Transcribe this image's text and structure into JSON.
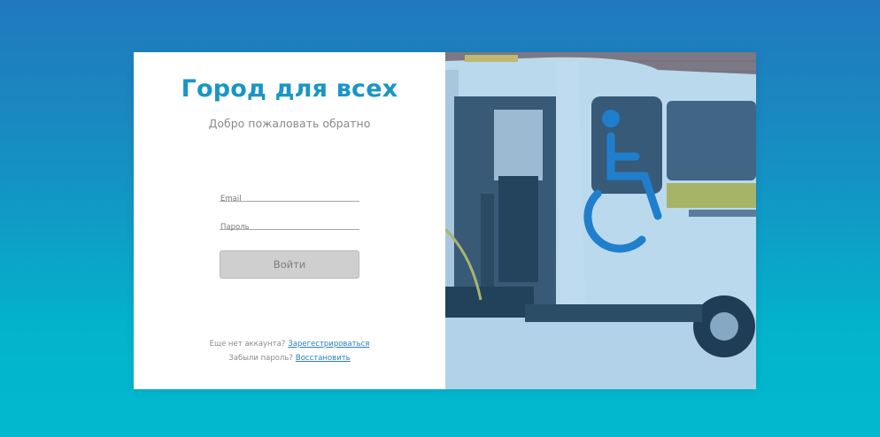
{
  "app": {
    "title": "Город для всех",
    "subtitle": "Добро пожаловать обратно"
  },
  "form": {
    "email_placeholder": "Email",
    "email_value": "",
    "password_placeholder": "Пароль",
    "password_value": "",
    "submit_label": "Войти"
  },
  "footer": {
    "register_prompt": "Еще нет аккаунта?",
    "register_link": "Зарегестрироваться",
    "recover_prompt": "Забыли пароль?",
    "recover_link": "Восстановить"
  },
  "colors": {
    "brand": "#1a96c4",
    "link": "#2a7fc0",
    "button_bg": "#cfcfcf",
    "background_top": "#2178bd",
    "background_bottom": "#02b9cf"
  },
  "icons": [
    "wheelchair-accessibility-icon"
  ]
}
